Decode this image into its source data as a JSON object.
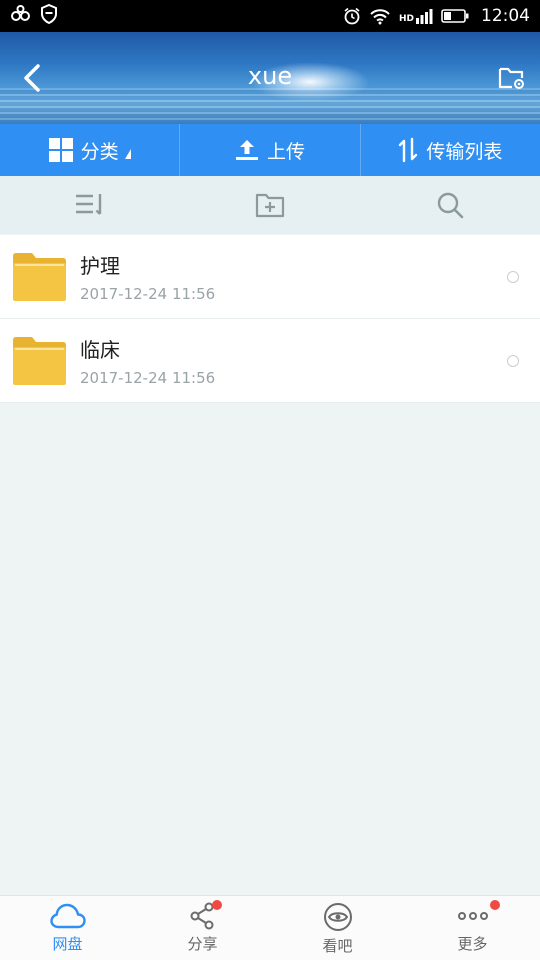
{
  "status_bar": {
    "time": "12:04",
    "left_icons": [
      "baidu-paw-icon",
      "shield-icon"
    ],
    "right_icons": [
      "alarm-icon",
      "wifi-icon",
      "hd-signal-icon",
      "battery-icon"
    ],
    "hd_label": "HD"
  },
  "header": {
    "title": "xue",
    "back_icon": "chevron-left-icon",
    "settings_icon": "folder-settings-icon"
  },
  "toolbar": {
    "category_label": "分类",
    "upload_label": "上传",
    "transfer_label": "传输列表"
  },
  "actions": {
    "sort_icon": "sort-icon",
    "new_folder_icon": "new-folder-icon",
    "search_icon": "search-icon"
  },
  "files": [
    {
      "name": "护理",
      "date": "2017-12-24  11:56"
    },
    {
      "name": "临床",
      "date": "2017-12-24  11:56"
    }
  ],
  "bottom_nav": [
    {
      "label": "网盘",
      "icon": "cloud-icon",
      "active": true,
      "badge": false
    },
    {
      "label": "分享",
      "icon": "share-icon",
      "active": false,
      "badge": true
    },
    {
      "label": "看吧",
      "icon": "eye-icon",
      "active": false,
      "badge": false
    },
    {
      "label": "更多",
      "icon": "more-icon",
      "active": false,
      "badge": true
    }
  ],
  "colors": {
    "accent": "#2f8ff2",
    "folder": "#f4c542",
    "badge": "#f04a43"
  }
}
